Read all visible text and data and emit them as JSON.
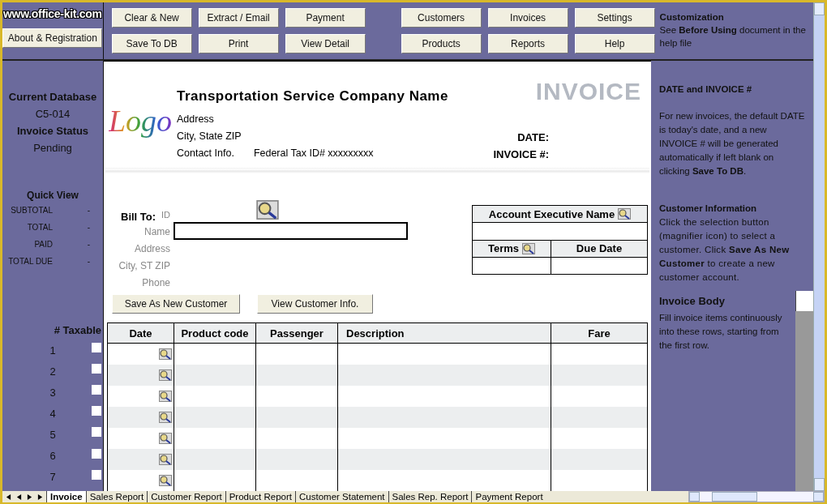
{
  "site_label": "www.office-kit.com",
  "about_button": "About & Registration",
  "toolbar_rows": [
    [
      "Clear & New",
      "Extract / Email",
      "Payment",
      "Customers",
      "Invoices",
      "Settings"
    ],
    [
      "Save To DB",
      "Print",
      "View Detail",
      "Products",
      "Reports",
      "Help"
    ]
  ],
  "customization": {
    "title": "Customization",
    "text": "See **Before Using** document in the help file"
  },
  "status_panel": {
    "database_label": "Current Database",
    "database": "C5-014",
    "status_label": "Invoice Status",
    "status": "Pending"
  },
  "quick_view": {
    "title": "Quick  View",
    "items": [
      {
        "label": "SUBTOTAL",
        "value": "-"
      },
      {
        "label": "TOTAL",
        "value": "-"
      },
      {
        "label": "PAID",
        "value": "-"
      },
      {
        "label": "TOTAL DUE",
        "value": "-"
      }
    ]
  },
  "taxable_header": "# Taxable",
  "rows": [
    {
      "number": "1",
      "taxable": false
    },
    {
      "number": "2",
      "taxable": false
    },
    {
      "number": "3",
      "taxable": false
    },
    {
      "number": "4",
      "taxable": false
    },
    {
      "number": "5",
      "taxable": false
    },
    {
      "number": "6",
      "taxable": false
    },
    {
      "number": "7",
      "taxable": false
    }
  ],
  "company": {
    "logo_text": "Logo",
    "name": "Transportation Service Company Name",
    "address": "Address",
    "city": "City, State ZIP",
    "contact": "Contact Info.",
    "tax_id": "Federal Tax ID# xxxxxxxxx"
  },
  "invoice_title": "INVOICE",
  "date_label": "DATE:",
  "invoice_no_label": "INVOICE #:",
  "bill_to": {
    "title": "Bill To:",
    "fields": [
      "ID",
      "Name",
      "Address",
      "City, ST ZIP",
      "Phone"
    ]
  },
  "customer_buttons": [
    "Save As New Customer",
    "View Customer Info."
  ],
  "account": {
    "executive_label": "Account Executive Name",
    "terms_label": "Terms",
    "due_date_label": "Due Date"
  },
  "table": {
    "columns": [
      "Date",
      "Product code",
      "Passenger",
      "Description",
      "Fare"
    ]
  },
  "help": [
    {
      "title": "DATE and INVOICE #",
      "text": "For new invoices, the default DATE is today's date, and a new INVOICE # will be generated automatically if left blank  on clicking **Save To DB**."
    },
    {
      "title": "Customer Information",
      "text": "Click the selection button (magnifier icon) to select a customer. Click **Save As New Customer** to create a new customer account."
    },
    {
      "title": "Invoice Body",
      "text": "Fill invoice items continuously into these rows, starting from the first row."
    }
  ],
  "sheet_tabs": [
    {
      "label": "Invoice",
      "selected": true
    },
    {
      "label": "Sales Report",
      "selected": false
    },
    {
      "label": "Customer Report",
      "selected": false
    },
    {
      "label": "Product Report",
      "selected": false
    },
    {
      "label": "Customer Statement",
      "selected": false
    },
    {
      "label": "Sales Rep. Report",
      "selected": false
    },
    {
      "label": "Payment Report",
      "selected": false
    }
  ]
}
